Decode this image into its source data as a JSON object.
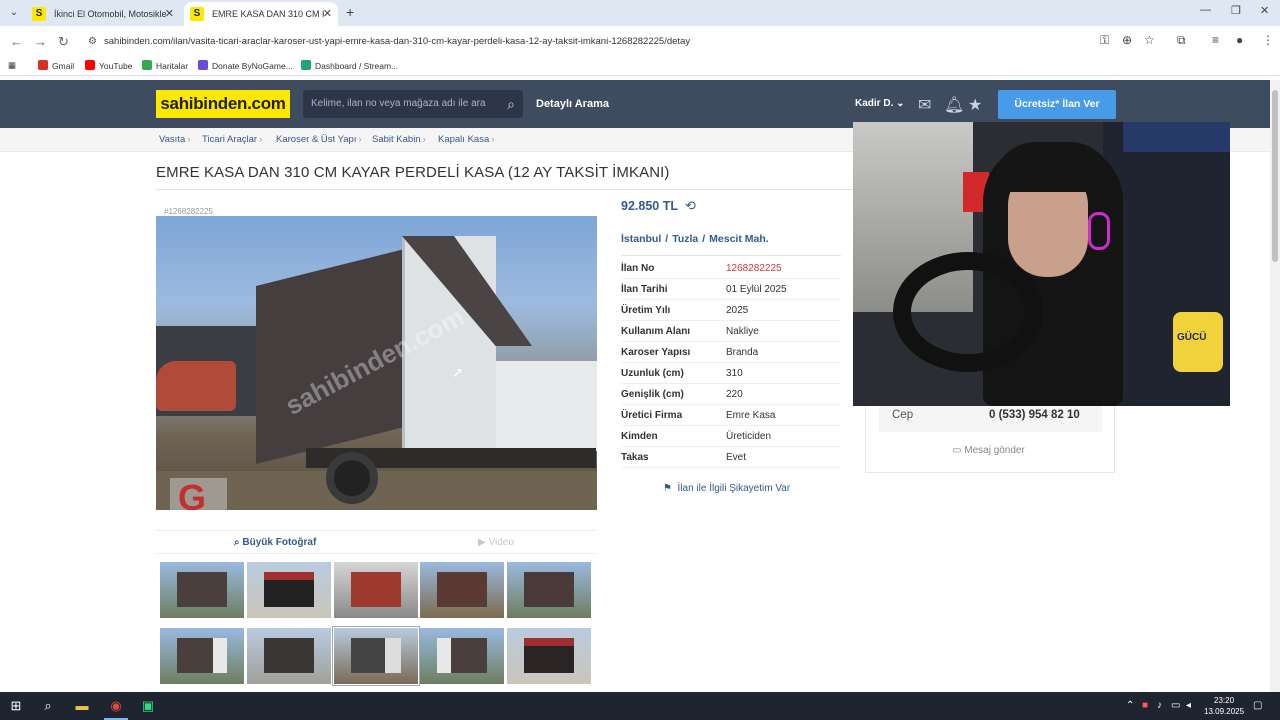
{
  "browser": {
    "tabs": [
      {
        "title": "İkinci El Otomobil, Motosiklet M"
      },
      {
        "title": "EMRE KASA DAN 310 CM KAYAR"
      }
    ],
    "url": "sahibinden.com/ilan/vasita-ticari-araclar-karoser-ust-yapi-emre-kasa-dan-310-cm-kayar-perdeli-kasa-12-ay-taksit-imkani-1268282225/detay",
    "bookmarks": [
      {
        "label": "Gmail",
        "icon_color": "#d93025"
      },
      {
        "label": "YouTube",
        "icon_color": "#ff0000"
      },
      {
        "label": "Haritalar",
        "icon_color": "#34a853"
      },
      {
        "label": "Donate ByNoGame...",
        "icon_color": "#6a4bd6"
      },
      {
        "label": "Dashboard / Stream...",
        "icon_color": "#1fa37b"
      }
    ]
  },
  "site": {
    "logo": "sahibinden.com",
    "search_placeholder": "Kelime, ilan no veya mağaza adı ile ara",
    "advanced_search": "Detaylı Arama",
    "user_name": "Kadir D.",
    "post_button": "Ücretsiz* İlan Ver",
    "brand_color": "#ffe800",
    "header_color": "#3f4b5e",
    "accent_color": "#489be8"
  },
  "breadcrumb": [
    "Vasıta",
    "Ticari Araçlar",
    "Karoser & Üst Yapı",
    "Sabit Kabin",
    "Kapalı Kasa"
  ],
  "listing": {
    "title": "EMRE KASA DAN 310 CM KAYAR PERDELİ KASA (12 AY TAKSİT İMKANI)",
    "photo_id": "#1268282225",
    "watermark": "sahibinden.com",
    "big_photo_label": "Büyük Fotoğraf",
    "video_label": "Video",
    "price": "92.850 TL",
    "location": [
      "İstanbul",
      "Tuzla",
      "Mescit Mah."
    ],
    "details": [
      {
        "key": "İlan No",
        "value": "1268282225"
      },
      {
        "key": "İlan Tarihi",
        "value": "01 Eylül 2025"
      },
      {
        "key": "Üretim Yılı",
        "value": "2025"
      },
      {
        "key": "Kullanım Alanı",
        "value": "Nakliye"
      },
      {
        "key": "Karoser Yapısı",
        "value": "Branda"
      },
      {
        "key": "Uzunluk (cm)",
        "value": "310"
      },
      {
        "key": "Genişlik (cm)",
        "value": "220"
      },
      {
        "key": "Üretici Firma",
        "value": "Emre Kasa"
      },
      {
        "key": "Kimden",
        "value": "Üreticiden"
      },
      {
        "key": "Takas",
        "value": "Evet"
      }
    ],
    "complaint_link": "İlan ile İlgili Şikayetim Var"
  },
  "seller": {
    "phone_label": "Cep",
    "phone": "0 (533) 954 82 10",
    "message_label": "Mesaj gönder"
  },
  "webcam": {
    "crest_text": "GÜCÜ"
  },
  "taskbar": {
    "time": "23:20",
    "date": "13.09.2025"
  }
}
